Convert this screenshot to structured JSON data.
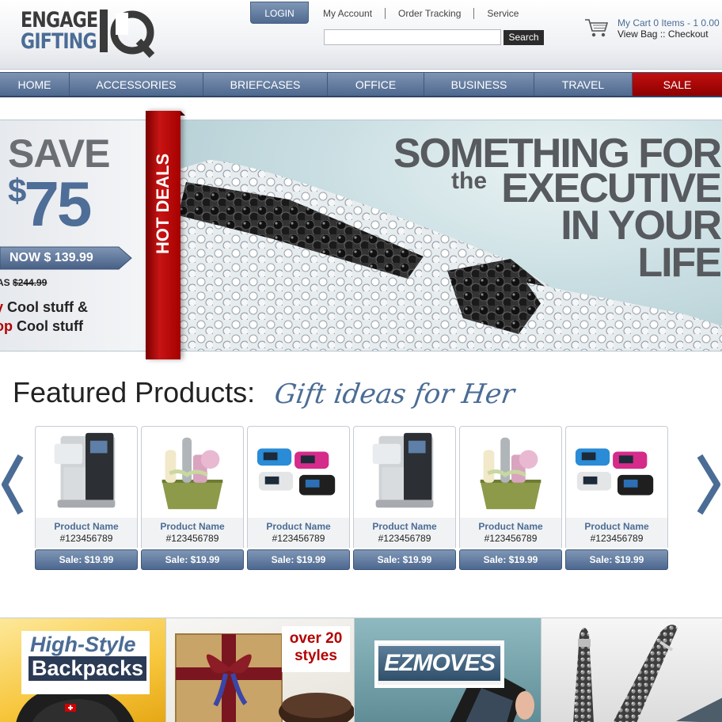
{
  "brand": {
    "logo_line1": "ENGAGE",
    "logo_line2": "GIFTING",
    "logo_iq": "IQ"
  },
  "header": {
    "login_label": "LOGIN",
    "links": [
      "My Account",
      "Order Tracking",
      "Service"
    ],
    "search_placeholder": "",
    "search_button": "Search",
    "cart_summary": "My Cart 0 Items - 1 0.00",
    "view_bag": "View Bag",
    "cart_separator": "::",
    "checkout": "Checkout"
  },
  "nav": {
    "items": [
      "HOME",
      "ACCESSORIES",
      "BRIEFCASES",
      "OFFICE",
      "BUSINESS",
      "TRAVEL",
      "SALE"
    ]
  },
  "hero": {
    "save_word": "SAVE",
    "save_currency": "$",
    "save_amount": "75",
    "now_price": "NOW  $ 139.99",
    "was_label": "AS",
    "was_price": "$244.99",
    "line1_red": "y",
    "line1_text": " Cool stuff &",
    "line2_red": "op",
    "line2_text": " Cool stuff",
    "ribbon": "HOT DEALS",
    "headline_1": "SOMETHING FOR",
    "headline_the": "the",
    "headline_2": "EXECUTIVE",
    "headline_3": "IN YOUR",
    "headline_4": "LIFE"
  },
  "featured": {
    "title": "Featured Products:",
    "subtitle": "Gift ideas for Her",
    "products": [
      {
        "name": "Product Name",
        "sku": "#123456789",
        "price": "Sale: $19.99",
        "image": "coffee-maker"
      },
      {
        "name": "Product Name",
        "sku": "#123456789",
        "price": "Sale: $19.99",
        "image": "spa-gift-basket"
      },
      {
        "name": "Product Name",
        "sku": "#123456789",
        "price": "Sale: $19.99",
        "image": "portable-speakers"
      },
      {
        "name": "Product Name",
        "sku": "#123456789",
        "price": "Sale: $19.99",
        "image": "coffee-maker"
      },
      {
        "name": "Product Name",
        "sku": "#123456789",
        "price": "Sale: $19.99",
        "image": "spa-gift-basket"
      },
      {
        "name": "Product Name",
        "sku": "#123456789",
        "price": "Sale: $19.99",
        "image": "portable-speakers"
      }
    ]
  },
  "promos": {
    "backpacks_line1": "High-Style",
    "backpacks_line2": "Backpacks",
    "gift_line1": "over 20",
    "gift_line2": "styles",
    "ezmoves": "EZMOVES"
  },
  "colors": {
    "nav_blue": "#5d779c",
    "sale_red": "#a80000",
    "accent_blue": "#4b6c95",
    "headline_gray": "#575a5e"
  }
}
